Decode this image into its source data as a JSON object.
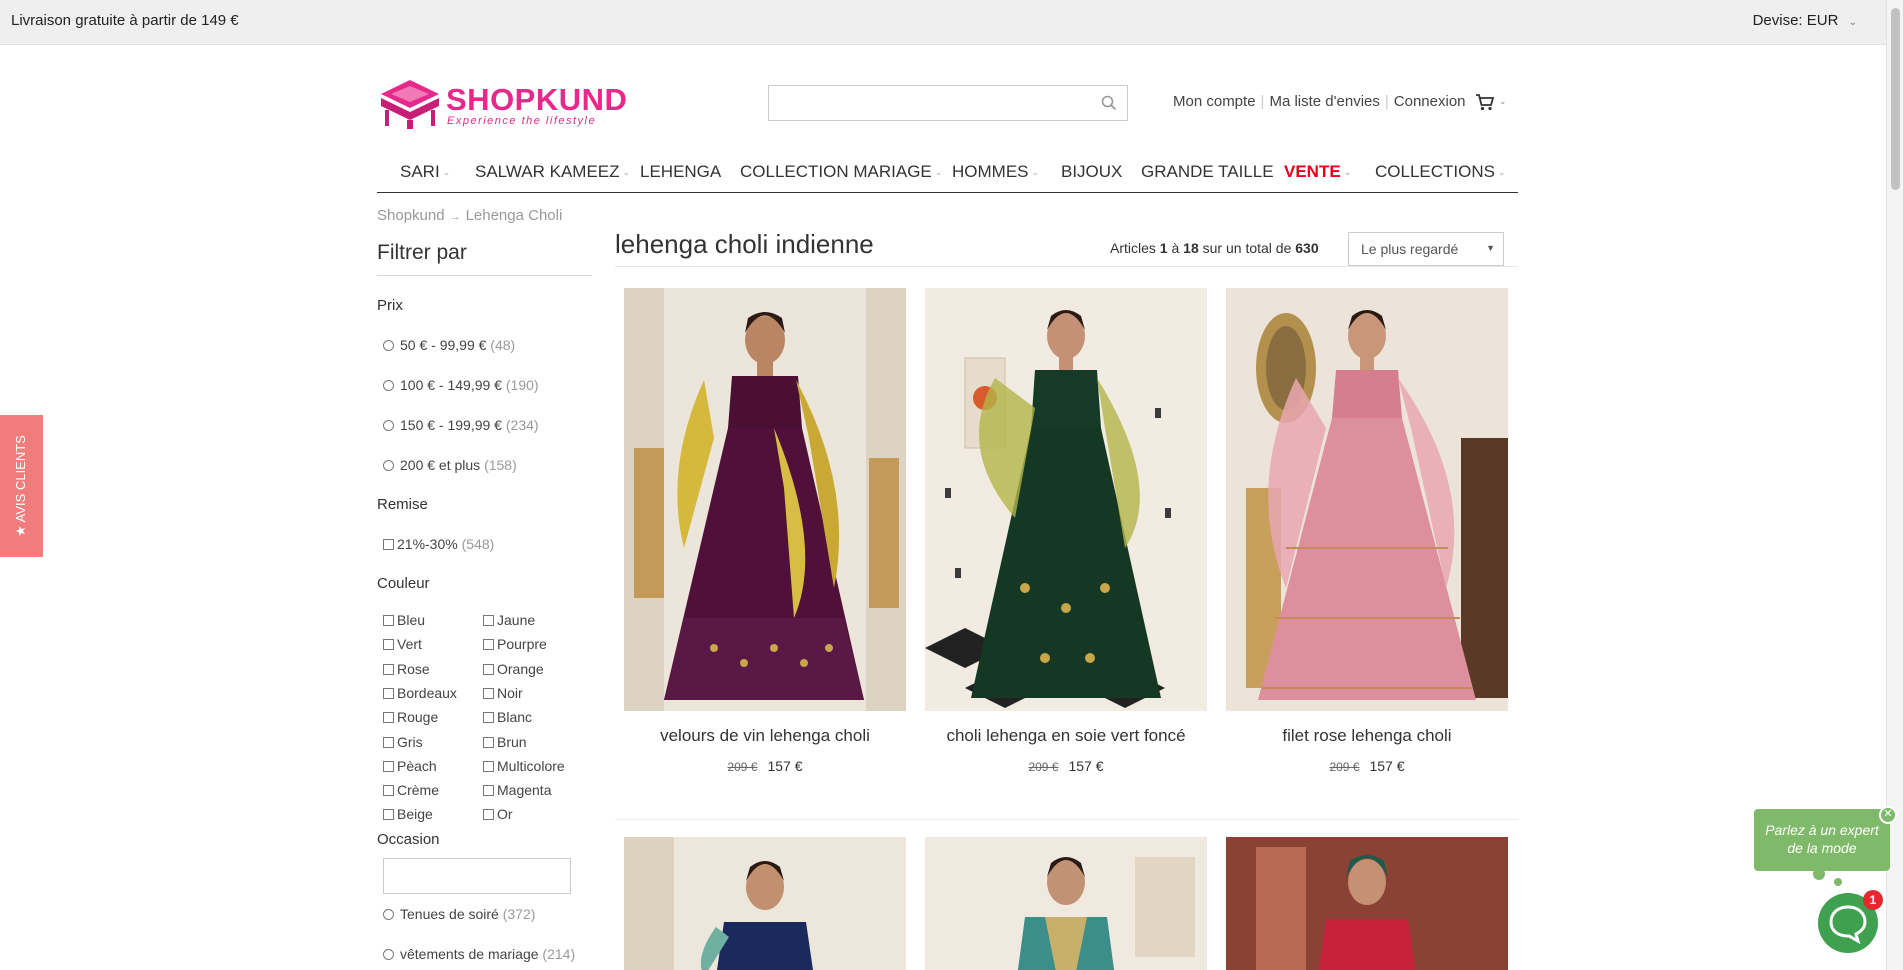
{
  "topbar": {
    "promo": "Livraison gratuite à partir de 149 €",
    "currency_label": "Devise:",
    "currency_value": "EUR"
  },
  "logo": {
    "brand": "SHOPKUND",
    "tagline": "Experience the lifestyle"
  },
  "search": {
    "placeholder": "",
    "value": ""
  },
  "account": {
    "my_account": "Mon compte",
    "wishlist": "Ma liste d'envies",
    "login": "Connexion"
  },
  "nav": {
    "items": [
      {
        "label": "SARI",
        "dropdown": true
      },
      {
        "label": "SALWAR KAMEEZ",
        "dropdown": true
      },
      {
        "label": "LEHENGA",
        "dropdown": false
      },
      {
        "label": "COLLECTION MARIAGE",
        "dropdown": true
      },
      {
        "label": "HOMMES",
        "dropdown": true
      },
      {
        "label": "BIJOUX",
        "dropdown": false
      },
      {
        "label": "GRANDE TAILLE",
        "dropdown": false
      },
      {
        "label": "VENTE",
        "dropdown": true
      },
      {
        "label": "COLLECTIONS",
        "dropdown": true
      }
    ]
  },
  "breadcrumb": {
    "home": "Shopkund",
    "current": "Lehenga Choli"
  },
  "filters": {
    "title": "Filtrer par",
    "price": {
      "label": "Prix",
      "options": [
        {
          "label": "50 € - 99,99 €",
          "count": "(48)"
        },
        {
          "label": "100 € - 149,99 €",
          "count": "(190)"
        },
        {
          "label": "150 € - 199,99 €",
          "count": "(234)"
        },
        {
          "label": "200 € et plus",
          "count": "(158)"
        }
      ]
    },
    "discount": {
      "label": "Remise",
      "options": [
        {
          "label": "21%-30%",
          "count": "(548)"
        }
      ]
    },
    "color": {
      "label": "Couleur",
      "left": [
        "Bleu",
        "Vert",
        "Rose",
        "Bordeaux",
        "Rouge",
        "Gris",
        "Pèach",
        "Crème",
        "Beige"
      ],
      "right": [
        "Jaune",
        "Pourpre",
        "Orange",
        "Noir",
        "Blanc",
        "Brun",
        "Multicolore",
        "Magenta",
        "Or"
      ]
    },
    "occasion": {
      "label": "Occasion",
      "options": [
        {
          "label": "Tenues de soiré",
          "count": "(372)"
        },
        {
          "label": "vêtements de mariage",
          "count": "(214)"
        }
      ]
    }
  },
  "listing": {
    "title": "lehenga choli indienne",
    "count_prefix": "Articles",
    "range_start": "1",
    "range_sep": "à",
    "range_end": "18",
    "total_prefix": "sur un total de",
    "total": "630",
    "sort_value": "Le plus regardé",
    "products": [
      {
        "name": "velours de vin lehenga choli",
        "old_price": "209 €",
        "price": "157 €"
      },
      {
        "name": "choli lehenga en soie vert foncé",
        "old_price": "209 €",
        "price": "157 €"
      },
      {
        "name": "filet rose lehenga choli",
        "old_price": "209 €",
        "price": "157 €"
      }
    ]
  },
  "reviews_tab": {
    "label": "★ AVIS CLIENTS"
  },
  "chat": {
    "line1": "Parlez à un expert",
    "line2": "de la mode",
    "close": "✕",
    "badge": "1"
  },
  "colors": {
    "brand": "#e6298b",
    "sale": "#e5001b",
    "chat": "#7fba6a",
    "reviews": "#f07c7c"
  }
}
